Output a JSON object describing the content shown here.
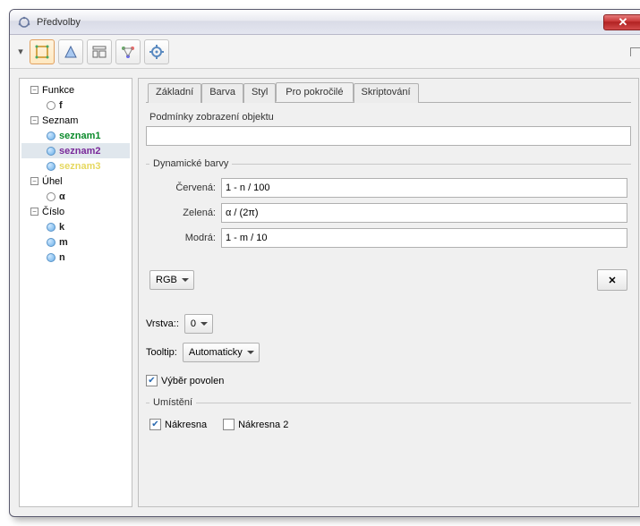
{
  "window": {
    "title": "Předvolby"
  },
  "tree": {
    "cats": [
      {
        "label": "Funkce",
        "items": [
          {
            "label": "f",
            "dot": "gray"
          }
        ]
      },
      {
        "label": "Seznam",
        "items": [
          {
            "label": "seznam1",
            "dot": "blue",
            "cls": "green"
          },
          {
            "label": "seznam2",
            "dot": "blue",
            "cls": "purple",
            "sel": true
          },
          {
            "label": "seznam3",
            "dot": "blue",
            "cls": "yellow"
          }
        ]
      },
      {
        "label": "Úhel",
        "items": [
          {
            "label": "α",
            "dot": "gray"
          }
        ]
      },
      {
        "label": "Číslo",
        "items": [
          {
            "label": "k",
            "dot": "blue"
          },
          {
            "label": "m",
            "dot": "blue"
          },
          {
            "label": "n",
            "dot": "blue"
          }
        ]
      }
    ]
  },
  "tabs": {
    "items": [
      "Základní",
      "Barva",
      "Styl",
      "Pro pokročilé",
      "Skriptování"
    ],
    "active": 3
  },
  "panel": {
    "condition_label": "Podmínky zobrazení objektu",
    "condition_value": "",
    "dyncolors_label": "Dynamické barvy",
    "colors": {
      "red_label": "Červená:",
      "red_value": "1 - n / 100",
      "green_label": "Zelená:",
      "green_value": "α / (2π)",
      "blue_label": "Modrá:",
      "blue_value": "1 - m / 10"
    },
    "mode": "RGB",
    "delete_symbol": "✕",
    "layer_label": "Vrstva::",
    "layer_value": "0",
    "tooltip_label": "Tooltip:",
    "tooltip_value": "Automaticky",
    "selection_label": "Výběr povolen",
    "selection_checked": true,
    "location_label": "Umístění",
    "loc1_label": "Nákresna",
    "loc1_checked": true,
    "loc2_label": "Nákresna 2",
    "loc2_checked": false
  }
}
